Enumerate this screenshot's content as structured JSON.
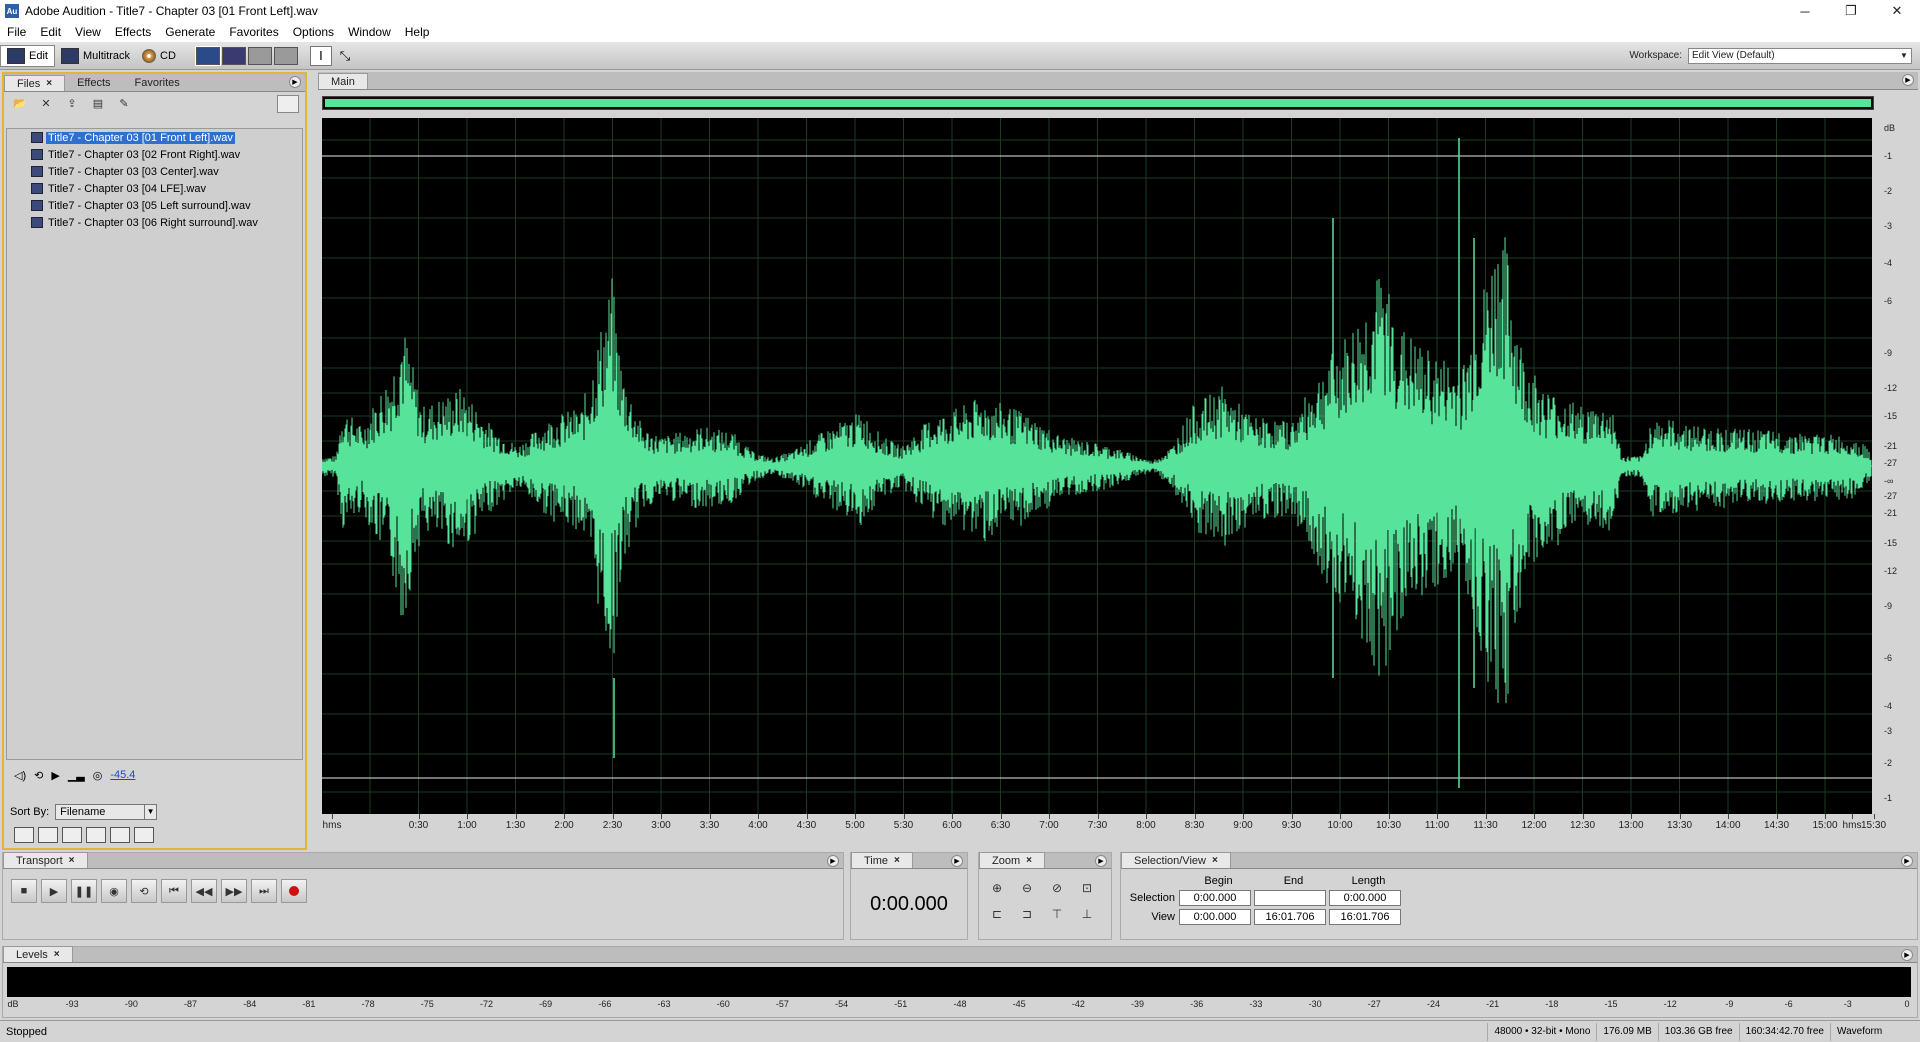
{
  "window": {
    "app_icon": "Au",
    "title": "Adobe Audition - Title7 - Chapter 03 [01 Front Left].wav",
    "minimize": "─",
    "restore": "❐",
    "close": "✕"
  },
  "menu": [
    "File",
    "Edit",
    "View",
    "Effects",
    "Generate",
    "Favorites",
    "Options",
    "Window",
    "Help"
  ],
  "toolbar": {
    "edit_label": "Edit",
    "multitrack_label": "Multitrack",
    "cd_label": "CD",
    "workspace_label": "Workspace:",
    "workspace_value": "Edit View (Default)"
  },
  "files_panel": {
    "tabs": [
      "Files",
      "Effects",
      "Favorites"
    ],
    "files": [
      "Title7 - Chapter 03 [01 Front Left].wav",
      "Title7 - Chapter 03 [02 Front Right].wav",
      "Title7 - Chapter 03 [03 Center].wav",
      "Title7 - Chapter 03 [04 LFE].wav",
      "Title7 - Chapter 03 [05 Left surround].wav",
      "Title7 - Chapter 03 [06 Right surround].wav"
    ],
    "selected_index": 0,
    "preview_volume": "-45.4",
    "sort_by_label": "Sort By:",
    "sort_by_value": "Filename"
  },
  "main_panel": {
    "tab": "Main",
    "wave_color": "#58e39a",
    "db_labels": [
      "dB",
      "-1",
      "-2",
      "-3",
      "-4",
      "-6",
      "-9",
      "-12",
      "-15",
      "-21",
      "-27",
      "-∞",
      "-27",
      "-21",
      "-15",
      "-12",
      "-9",
      "-6",
      "-4",
      "-3",
      "-2",
      "-1"
    ],
    "time_labels": [
      "hms",
      "0:30",
      "1:00",
      "1:30",
      "2:00",
      "2:30",
      "3:00",
      "3:30",
      "4:00",
      "4:30",
      "5:00",
      "5:30",
      "6:00",
      "6:30",
      "7:00",
      "7:30",
      "8:00",
      "8:30",
      "9:00",
      "9:30",
      "10:00",
      "10:30",
      "11:00",
      "11:30",
      "12:00",
      "12:30",
      "13:00",
      "13:30",
      "14:00",
      "14:30",
      "15:00",
      "15:30",
      "hms"
    ]
  },
  "transport": {
    "tab": "Transport"
  },
  "time_panel": {
    "tab": "Time",
    "value": "0:00.000"
  },
  "zoom_panel": {
    "tab": "Zoom"
  },
  "selection_view": {
    "tab": "Selection/View",
    "headers": [
      "Begin",
      "End",
      "Length"
    ],
    "selection_label": "Selection",
    "view_label": "View",
    "selection": [
      "0:00.000",
      "",
      "0:00.000"
    ],
    "view": [
      "0:00.000",
      "16:01.706",
      "16:01.706"
    ]
  },
  "levels": {
    "tab": "Levels",
    "scale": [
      "dB",
      "-93",
      "-90",
      "-87",
      "-84",
      "-81",
      "-78",
      "-75",
      "-72",
      "-69",
      "-66",
      "-63",
      "-60",
      "-57",
      "-54",
      "-51",
      "-48",
      "-45",
      "-42",
      "-39",
      "-36",
      "-33",
      "-30",
      "-27",
      "-24",
      "-21",
      "-18",
      "-15",
      "-12",
      "-9",
      "-6",
      "-3",
      "0"
    ]
  },
  "status": {
    "state": "Stopped",
    "format": "48000 • 32-bit • Mono",
    "size": "176.09 MB",
    "free": "103.36 GB free",
    "time_free": "160:34:42.70 free",
    "view_mode": "Waveform"
  }
}
